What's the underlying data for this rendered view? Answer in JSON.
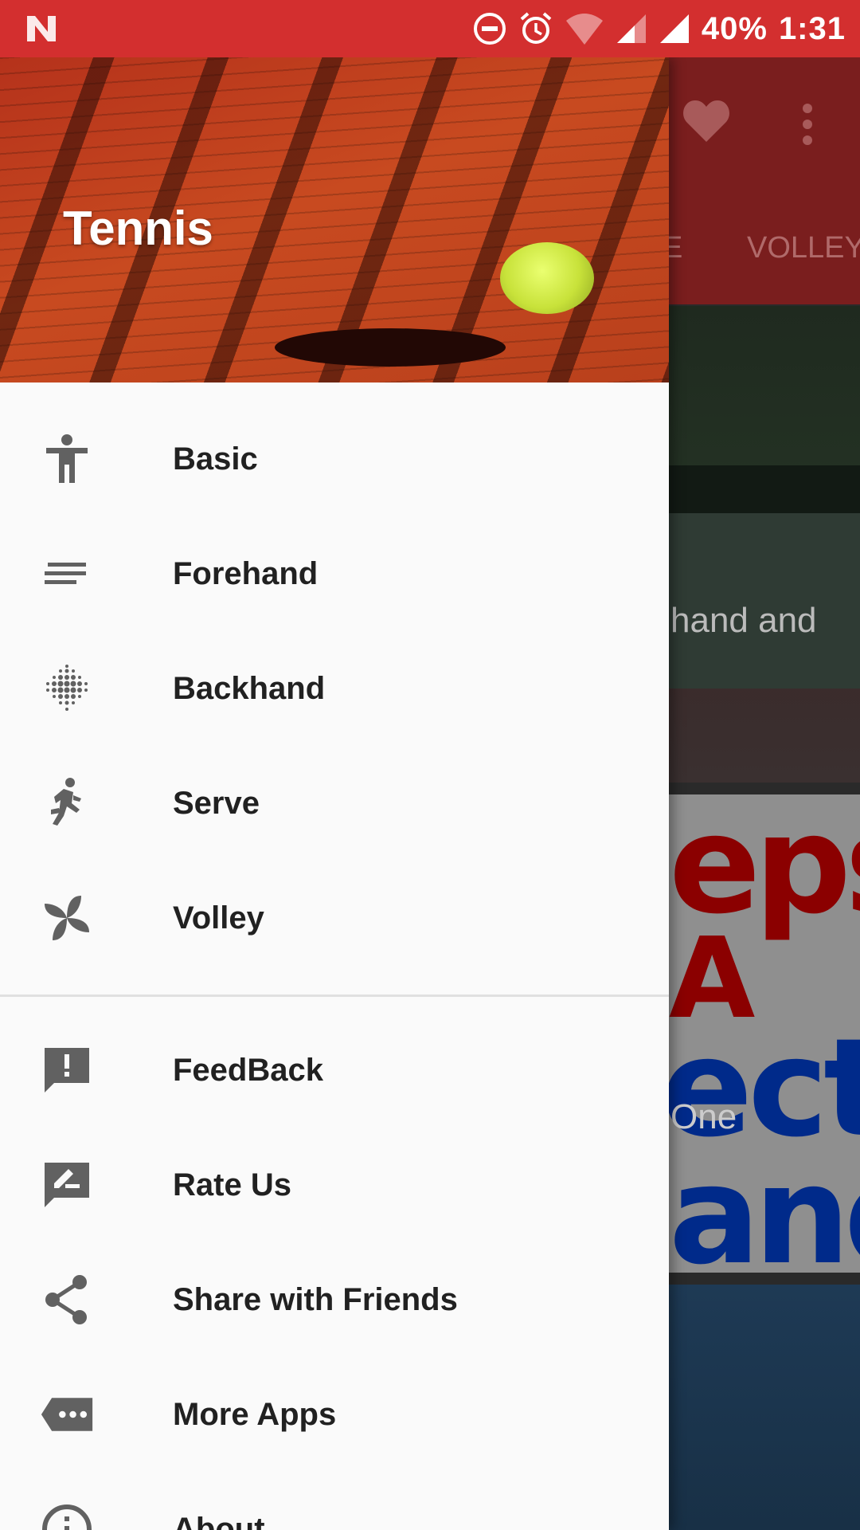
{
  "status_bar": {
    "battery": "40%",
    "time": "1:31",
    "icons": [
      "n-logo-icon",
      "dnd-icon",
      "alarm-icon",
      "wifi-icon",
      "signal-icon",
      "signal-icon-2"
    ]
  },
  "background_app": {
    "tabs": [
      "E",
      "VOLLEY"
    ],
    "cards": [
      {
        "caption": "hand and"
      },
      {
        "big_text": [
          "eps",
          "A",
          "ect",
          "and"
        ],
        "caption": "One"
      }
    ]
  },
  "drawer": {
    "title": "Tennis",
    "primary_items": [
      {
        "label": "Basic",
        "icon": "accessibility-icon"
      },
      {
        "label": "Forehand",
        "icon": "short-text-icon"
      },
      {
        "label": "Backhand",
        "icon": "dots-grid-icon"
      },
      {
        "label": "Serve",
        "icon": "run-icon"
      },
      {
        "label": "Volley",
        "icon": "pinwheel-icon"
      }
    ],
    "secondary_items": [
      {
        "label": "FeedBack",
        "icon": "feedback-icon"
      },
      {
        "label": "Rate Us",
        "icon": "rate-review-icon"
      },
      {
        "label": "Share with Friends",
        "icon": "share-icon"
      },
      {
        "label": "More Apps",
        "icon": "more-apps-icon"
      },
      {
        "label": "About",
        "icon": "info-icon"
      }
    ]
  },
  "colors": {
    "status_bar": "#d32f2f",
    "drawer_bg": "#fafafa",
    "menu_text": "#212121",
    "icon_gray": "#616161"
  }
}
